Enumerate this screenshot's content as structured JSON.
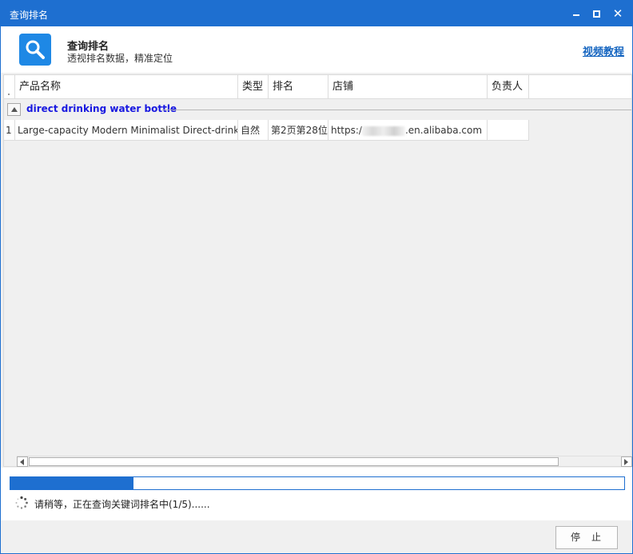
{
  "window": {
    "title": "查询排名"
  },
  "header": {
    "title": "查询排名",
    "subtitle": "透视排名数据，精准定位",
    "tutorial_link": "视频教程",
    "icon": "search-icon"
  },
  "grid": {
    "columns": [
      {
        "label": "产品名称"
      },
      {
        "label": "类型"
      },
      {
        "label": "排名"
      },
      {
        "label": "店铺"
      },
      {
        "label": "负责人"
      }
    ],
    "group": {
      "label": "direct drinking water bottle"
    },
    "rows": [
      {
        "index": "1",
        "product": "Large-capacity Modern Minimalist Direct-drink Sports Water Bottle",
        "type": "自然",
        "rank": "第2页第28位",
        "store_prefix": "https:/",
        "store_suffix": ".en.alibaba.com",
        "owner": ""
      }
    ]
  },
  "progress": {
    "fraction": 0.2,
    "status": "请稍等，正在查询关键词排名中(1/5)......"
  },
  "footer": {
    "stop_label": "停止"
  },
  "colors": {
    "accent": "#1e6fd0",
    "group_text": "#1818e0",
    "link": "#1565c0"
  }
}
